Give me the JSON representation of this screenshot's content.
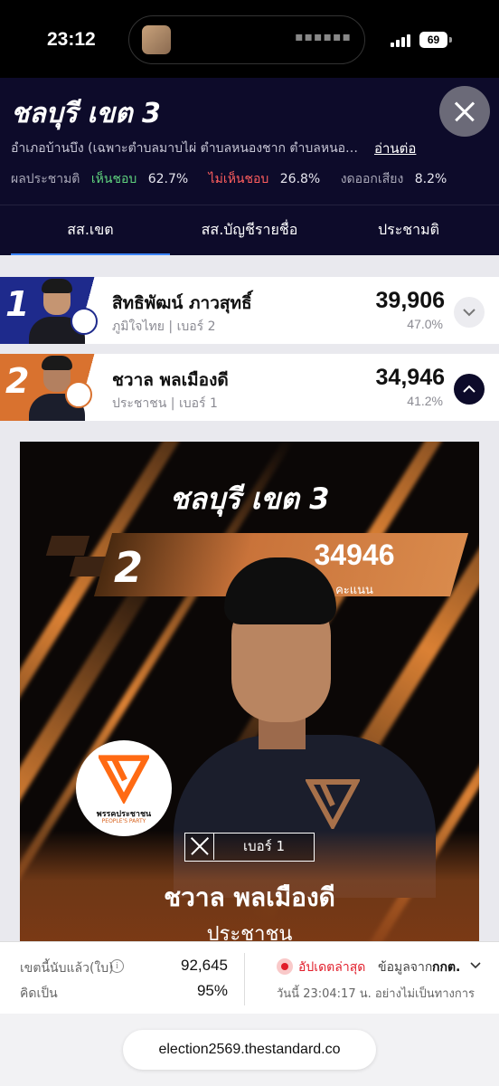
{
  "status_bar": {
    "time": "23:12",
    "battery": "69"
  },
  "header": {
    "title": "ชลบุรี เขต 3",
    "area_description": "อำเภอบ้านบึง (เฉพาะตำบลมาบไผ่ ตำบลหนองชาก ตำบลหนอง...",
    "read_more": "อ่านต่อ",
    "referendum": {
      "label": "ผลประชามติ",
      "agree_label": "เห็นชอบ",
      "agree_value": "62.7%",
      "disagree_label": "ไม่เห็นชอบ",
      "disagree_value": "26.8%",
      "abstain_label": "งดออกเสียง",
      "abstain_value": "8.2%",
      "agree_color": "#5fd37e",
      "disagree_color": "#ff5e5e"
    },
    "tabs": [
      {
        "label": "สส.เขต",
        "active": true
      },
      {
        "label": "สส.บัญชีรายชื่อ",
        "active": false
      },
      {
        "label": "ประชามติ",
        "active": false
      }
    ]
  },
  "candidates": [
    {
      "rank": "1",
      "name": "สิทธิพัฒน์ ภาวสุทธิ์",
      "party_number": "ภูมิใจไทย | เบอร์ 2",
      "votes": "39,906",
      "percent": "47.0%",
      "color": "#1e2a8c",
      "expanded": false
    },
    {
      "rank": "2",
      "name": "ชวาล พลเมืองดี",
      "party_number": "ประชาชน | เบอร์ 1",
      "votes": "34,946",
      "percent": "41.2%",
      "color": "#d9722f",
      "expanded": true
    }
  ],
  "card": {
    "title": "ชลบุรี เขต 3",
    "rank": "2",
    "votes": "34946",
    "votes_unit": "คะแนน",
    "party_logo_text": "พรรคประชาชน",
    "party_logo_text_en": "PEOPLE'S PARTY",
    "ballot_number": "เบอร์ 1",
    "name": "ชวาล พลเมืองดี",
    "party": "ประชาชน",
    "accent_color": "#d9722f"
  },
  "info_bar": {
    "counted_label": "เขตนี้นับแล้ว(ใบ)",
    "counted_value": "92,645",
    "percent_label": "คิดเป็น",
    "percent_value": "95%",
    "update_label": "อัปเดตล่าสุด",
    "source_label": "ข้อมูลจาก",
    "source_name": "กกต.",
    "timestamp": "วันนี้ 23:04:17 น. อย่างไม่เป็นทางการ"
  },
  "browser": {
    "url": "election2569.thestandard.co"
  }
}
